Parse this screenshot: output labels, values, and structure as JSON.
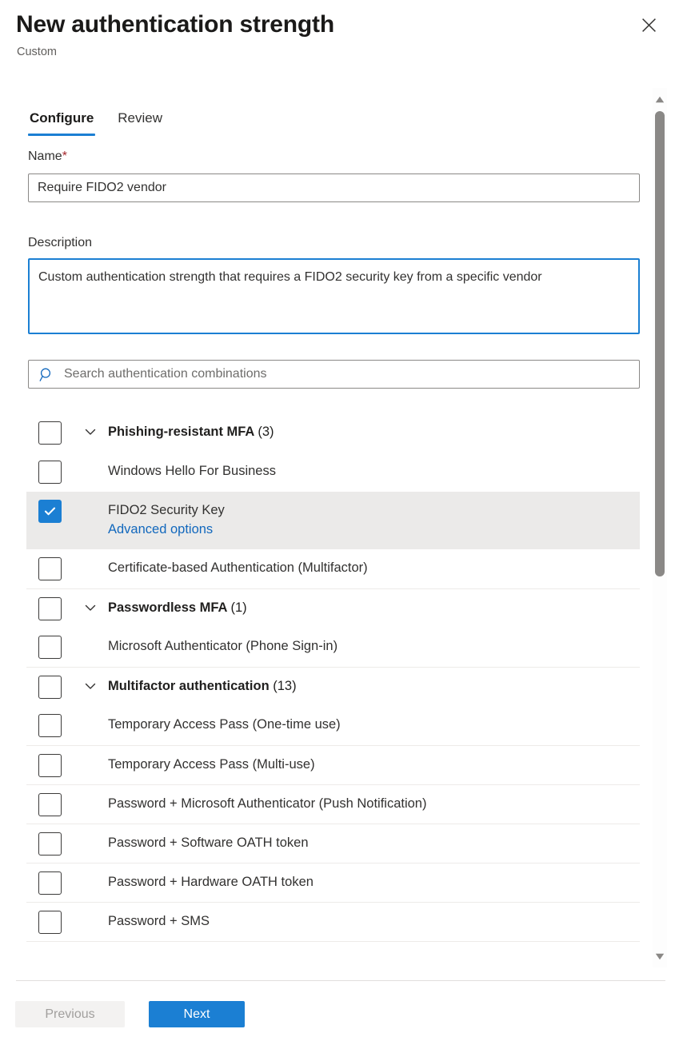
{
  "header": {
    "title": "New authentication strength",
    "subtitle": "Custom",
    "close_icon": "close-icon"
  },
  "tabs": [
    {
      "label": "Configure",
      "active": true
    },
    {
      "label": "Review",
      "active": false
    }
  ],
  "form": {
    "name_label": "Name",
    "name_required_marker": "*",
    "name_value": "Require FIDO2 vendor",
    "name_placeholder": "",
    "description_label": "Description",
    "description_value": "Custom authentication strength that requires a FIDO2 security key from a specific vendor",
    "description_placeholder": ""
  },
  "search": {
    "icon": "search-icon",
    "value": "",
    "placeholder": "Search authentication combinations"
  },
  "list": {
    "rows": [
      {
        "type": "group",
        "label": "Phishing-resistant MFA",
        "count": "(3)",
        "checked": false,
        "chevron": "chevron-down-icon",
        "separator": false
      },
      {
        "type": "item",
        "label": "Windows Hello For Business",
        "checked": false,
        "separator": false
      },
      {
        "type": "item",
        "label": "FIDO2 Security Key",
        "sublabel": "Advanced options",
        "checked": true,
        "selected": true,
        "separator": false
      },
      {
        "type": "item",
        "label": "Certificate-based Authentication (Multifactor)",
        "checked": false,
        "separator": false
      },
      {
        "type": "group",
        "label": "Passwordless MFA",
        "count": "(1)",
        "checked": false,
        "chevron": "chevron-down-icon",
        "separator": true
      },
      {
        "type": "item",
        "label": "Microsoft Authenticator (Phone Sign-in)",
        "checked": false,
        "separator": false
      },
      {
        "type": "group",
        "label": "Multifactor authentication",
        "count": "(13)",
        "checked": false,
        "chevron": "chevron-down-icon",
        "separator": true
      },
      {
        "type": "item",
        "label": "Temporary Access Pass (One-time use)",
        "checked": false,
        "separator": false
      },
      {
        "type": "item",
        "label": "Temporary Access Pass (Multi-use)",
        "checked": false,
        "separator": true
      },
      {
        "type": "item",
        "label": "Password + Microsoft Authenticator (Push Notification)",
        "checked": false,
        "separator": true
      },
      {
        "type": "item",
        "label": "Password + Software OATH token",
        "checked": false,
        "separator": true
      },
      {
        "type": "item",
        "label": "Password + Hardware OATH token",
        "checked": false,
        "separator": true
      },
      {
        "type": "item",
        "label": "Password + SMS",
        "checked": false,
        "separator": true
      }
    ]
  },
  "scrollbar": {
    "up_icon": "scroll-up-arrow-icon",
    "down_icon": "scroll-down-arrow-icon",
    "thumb": "scrollbar-thumb"
  },
  "footer": {
    "previous_label": "Previous",
    "previous_disabled": true,
    "next_label": "Next"
  },
  "colors": {
    "accent": "#1b7fd3",
    "link": "#1268bd",
    "required": "#a4262c",
    "selected_row_bg": "#ebeae9",
    "divider": "#edebe9",
    "disabled_bg": "#f3f2f1",
    "disabled_text": "#a19f9d"
  }
}
